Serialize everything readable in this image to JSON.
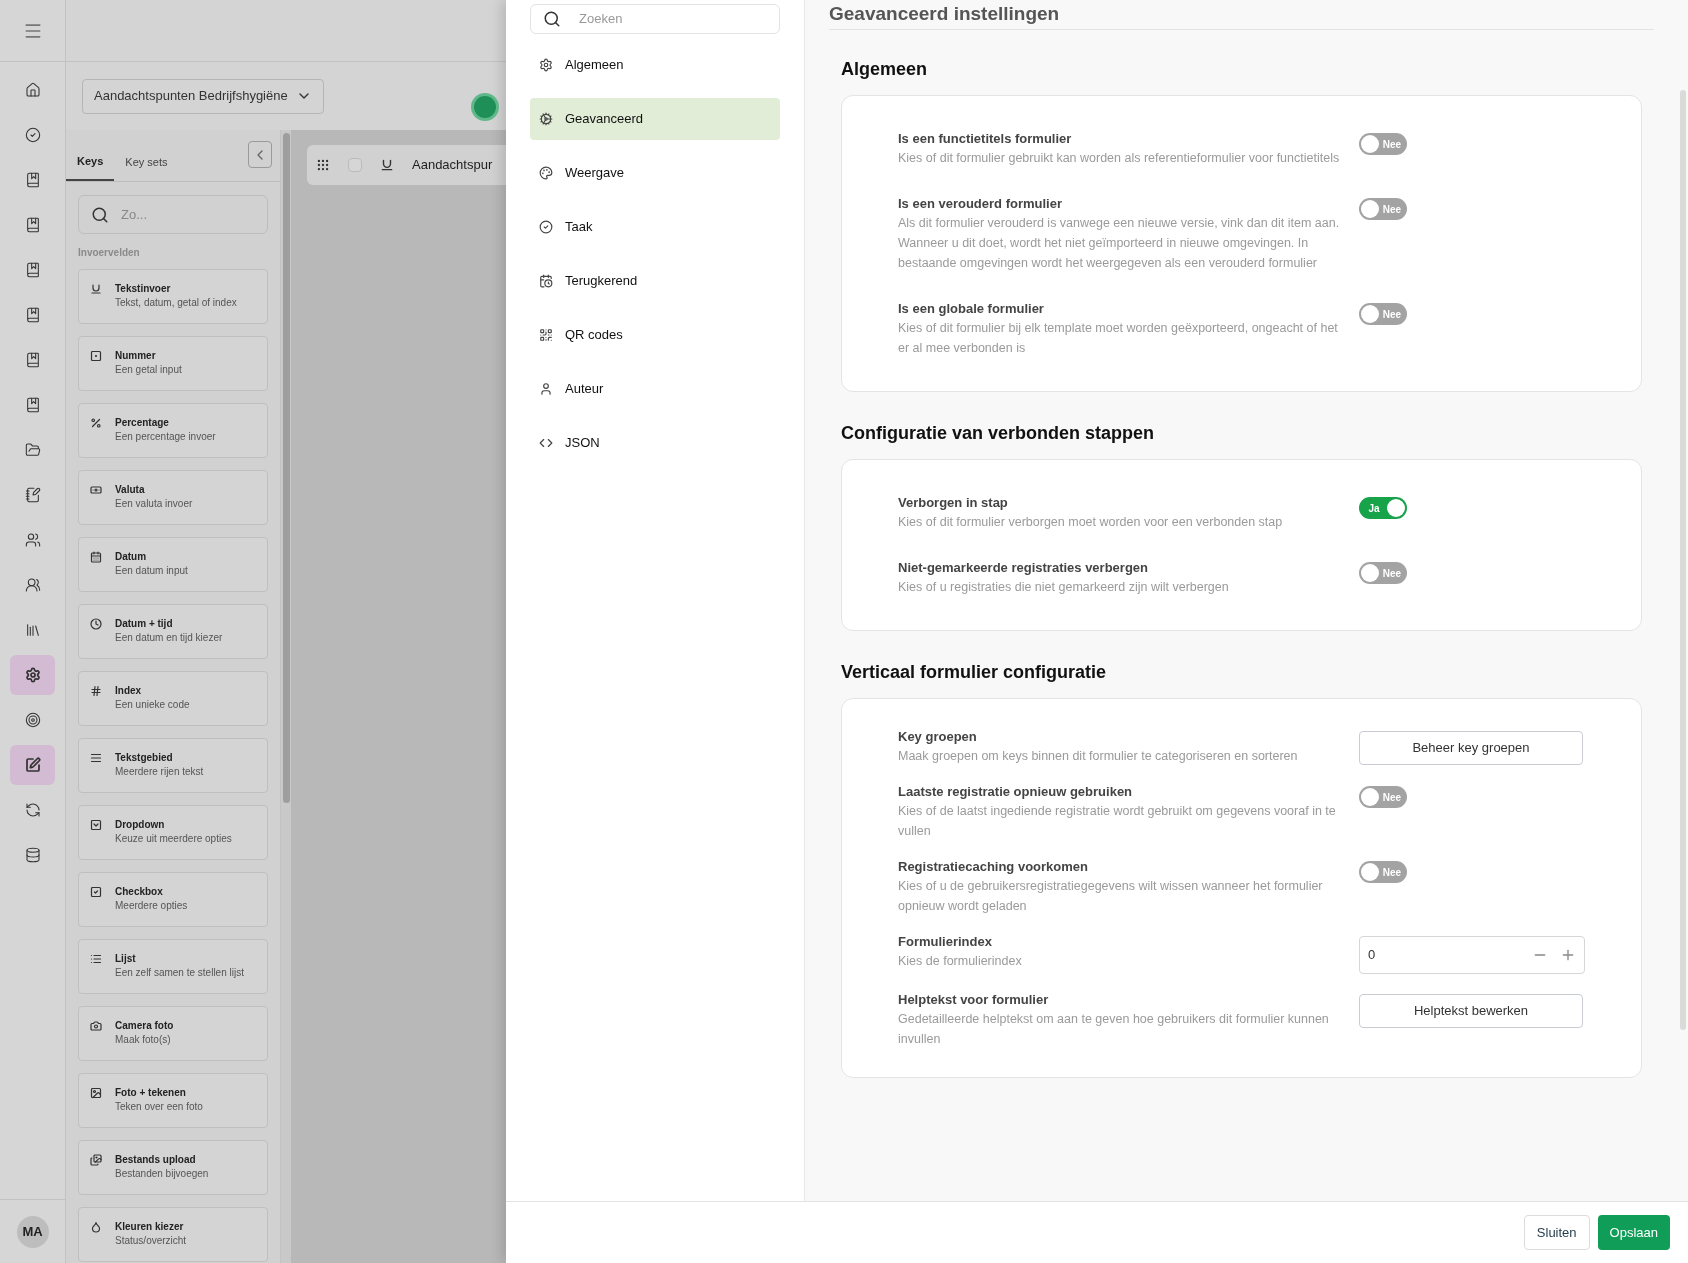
{
  "rail": {
    "items": [
      {
        "selected": false
      },
      {
        "selected": false
      },
      {
        "selected": false
      },
      {
        "selected": false
      },
      {
        "selected": false
      },
      {
        "selected": false
      },
      {
        "selected": false
      },
      {
        "selected": false
      },
      {
        "selected": false
      },
      {
        "selected": false
      },
      {
        "selected": false
      },
      {
        "selected": false
      },
      {
        "selected": false
      },
      {
        "selected": true
      },
      {
        "selected": false
      },
      {
        "selected": true
      },
      {
        "selected": false
      },
      {
        "selected": false
      }
    ],
    "avatar": "MA"
  },
  "form_selector": "Aandachtspunten Bedrijfshygiëne",
  "key_panel": {
    "tabs": [
      {
        "label": "Keys",
        "selected": true
      },
      {
        "label": "Key sets",
        "selected": false
      }
    ],
    "search": {
      "placeholder": "Zo..."
    },
    "section": "Invoervelden",
    "keys": [
      {
        "title": "Tekstinvoer",
        "subtitle": "Tekst, datum, getal of index"
      },
      {
        "title": "Nummer",
        "subtitle": "Een getal input"
      },
      {
        "title": "Percentage",
        "subtitle": "Een percentage invoer"
      },
      {
        "title": "Valuta",
        "subtitle": "Een valuta invoer"
      },
      {
        "title": "Datum",
        "subtitle": "Een datum input"
      },
      {
        "title": "Datum + tijd",
        "subtitle": "Een datum en tijd kiezer"
      },
      {
        "title": "Index",
        "subtitle": "Een unieke code"
      },
      {
        "title": "Tekstgebied",
        "subtitle": "Meerdere rijen tekst"
      },
      {
        "title": "Dropdown",
        "subtitle": "Keuze uit meerdere opties"
      },
      {
        "title": "Checkbox",
        "subtitle": "Meerdere opties"
      },
      {
        "title": "Lijst",
        "subtitle": "Een zelf samen te stellen lijst"
      },
      {
        "title": "Camera foto",
        "subtitle": "Maak foto(s)"
      },
      {
        "title": "Foto + tekenen",
        "subtitle": "Teken over een foto"
      },
      {
        "title": "Bestands upload",
        "subtitle": "Bestanden bijvoegen"
      },
      {
        "title": "Kleuren kiezer",
        "subtitle": "Status/overzicht"
      }
    ]
  },
  "canvas": {
    "row_title": "Aandachtspur",
    "checked": false
  },
  "modal": {
    "search": {
      "placeholder": "Zoeken"
    },
    "nav": [
      {
        "label": "Algemeen",
        "selected": false
      },
      {
        "label": "Geavanceerd",
        "selected": true
      },
      {
        "label": "Weergave",
        "selected": false
      },
      {
        "label": "Taak",
        "selected": false
      },
      {
        "label": "Terugkerend",
        "selected": false
      },
      {
        "label": "QR codes",
        "selected": false
      },
      {
        "label": "Auteur",
        "selected": false
      },
      {
        "label": "JSON",
        "selected": false
      }
    ],
    "title": "Geavanceerd instellingen",
    "sections": [
      {
        "title": "Algemeen",
        "rows": [
          {
            "kind": "toggle",
            "label": "Is een functietitels formulier",
            "description": "Kies of dit formulier gebruikt kan worden als referentieformulier voor functietitels",
            "on": false,
            "state_label": "Nee"
          },
          {
            "kind": "toggle",
            "label": "Is een verouderd formulier",
            "description": "Als dit formulier verouderd is vanwege een nieuwe versie, vink dan dit item aan. Wanneer u dit doet, wordt het niet geïmporteerd in nieuwe omgevingen. In bestaande omgevingen wordt het weergegeven als een verouderd formulier",
            "on": false,
            "state_label": "Nee"
          },
          {
            "kind": "toggle",
            "label": "Is een globale formulier",
            "description": "Kies of dit formulier bij elk template moet worden geëxporteerd, ongeacht of het er al mee verbonden is",
            "on": false,
            "state_label": "Nee"
          }
        ]
      },
      {
        "title": "Configuratie van verbonden stappen",
        "rows": [
          {
            "kind": "toggle",
            "label": "Verborgen in stap",
            "description": "Kies of dit formulier verborgen moet worden voor een verbonden stap",
            "on": true,
            "state_label": "Ja"
          },
          {
            "kind": "toggle",
            "label": "Niet-gemarkeerde registraties verbergen",
            "description": "Kies of u registraties die niet gemarkeerd zijn wilt verbergen",
            "on": false,
            "state_label": "Nee"
          }
        ]
      },
      {
        "title": "Verticaal formulier configuratie",
        "rows": [
          {
            "kind": "button",
            "label": "Key groepen",
            "description": "Maak groepen om keys binnen dit formulier te categoriseren en sorteren",
            "button": "Beheer key groepen"
          },
          {
            "kind": "toggle",
            "label": "Laatste registratie opnieuw gebruiken",
            "description": "Kies of de laatst ingediende registratie wordt gebruikt om gegevens vooraf in te vullen",
            "on": false,
            "state_label": "Nee"
          },
          {
            "kind": "toggle",
            "label": "Registratiecaching voorkomen",
            "description": "Kies of u de gebruikersregistratiegegevens wilt wissen wanneer het formulier opnieuw wordt geladen",
            "on": false,
            "state_label": "Nee"
          },
          {
            "kind": "number",
            "label": "Formulierindex",
            "description": "Kies de formulierindex",
            "value": "0"
          },
          {
            "kind": "button",
            "label": "Helptekst voor formulier",
            "description": "Gedetailleerde helptekst om aan te geven hoe gebruikers dit formulier kunnen invullen",
            "button": "Helptekst bewerken"
          }
        ]
      }
    ],
    "footer": {
      "buttons": [
        {
          "label": "Sluiten",
          "kind": "secondary"
        },
        {
          "label": "Opslaan",
          "kind": "primary"
        }
      ]
    }
  }
}
